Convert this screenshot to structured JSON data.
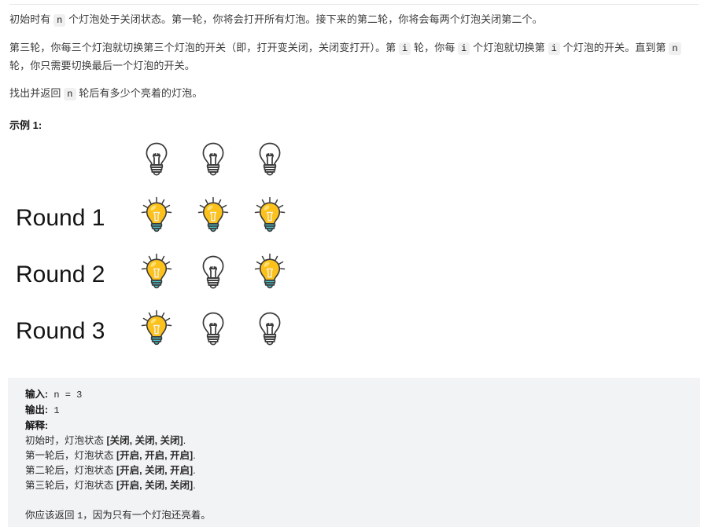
{
  "colors": {
    "page_bg": "#ffffff",
    "text": "#3c3c3c",
    "codeblock_bg": "#f2f3f5",
    "inline_code_bg": "#f0f0f0",
    "bulb_on_glass": "#fcc21b",
    "bulb_on_base": "#4dbfc6",
    "bulb_off_outline": "#3a3a3a",
    "rule": "#e5e5e5"
  },
  "description": {
    "paragraph1_part1": "初始时有 ",
    "paragraph1_code1": "n",
    "paragraph1_part2": " 个灯泡处于关闭状态。第一轮，你将会打开所有灯泡。接下来的第二轮，你将会每两个灯泡关闭第二个。",
    "paragraph2_part1": "第三轮，你每三个灯泡就切换第三个灯泡的开关（即，打开变关闭，关闭变打开）。第 ",
    "paragraph2_code1": "i",
    "paragraph2_part2": " 轮，你每 ",
    "paragraph2_code2": "i",
    "paragraph2_part3": " 个灯泡就切换第 ",
    "paragraph2_code3": "i",
    "paragraph2_part4": " 个灯泡的开关。直到第 ",
    "paragraph2_code4": "n",
    "paragraph2_part5": " 轮，你只需要切换最后一个灯泡的开关。",
    "paragraph3_part1": "找出并返回 ",
    "paragraph3_code1": "n",
    "paragraph3_part2": " 轮后有多少个亮着的灯泡。"
  },
  "example_heading": "示例 1:",
  "diagram": {
    "rows": [
      {
        "label": "",
        "bulbs": [
          "off",
          "off",
          "off"
        ]
      },
      {
        "label": "Round 1",
        "bulbs": [
          "on",
          "on",
          "on"
        ]
      },
      {
        "label": "Round 2",
        "bulbs": [
          "on",
          "off",
          "on"
        ]
      },
      {
        "label": "Round 3",
        "bulbs": [
          "on",
          "off",
          "off"
        ]
      }
    ]
  },
  "example": {
    "input_label": "输入:",
    "input_value": " n = 3",
    "output_label": "输出:",
    "output_value": " 1",
    "explanation_label": "解释:",
    "explanation_lines": [
      {
        "prefix": "初始时，灯泡状态 ",
        "states": "[关闭, 关闭, 关闭]",
        "suffix": "."
      },
      {
        "prefix": "第一轮后，灯泡状态 ",
        "states": "[开启, 开启, 开启]",
        "suffix": "."
      },
      {
        "prefix": "第二轮后，灯泡状态 ",
        "states": "[开启, 关闭, 开启]",
        "suffix": "."
      },
      {
        "prefix": "第三轮后，灯泡状态 ",
        "states": "[开启, 关闭, 关闭]",
        "suffix": "."
      }
    ],
    "conclusion_prefix": "你应该返回 ",
    "conclusion_value": "1",
    "conclusion_suffix": "，因为只有一个灯泡还亮着。"
  }
}
